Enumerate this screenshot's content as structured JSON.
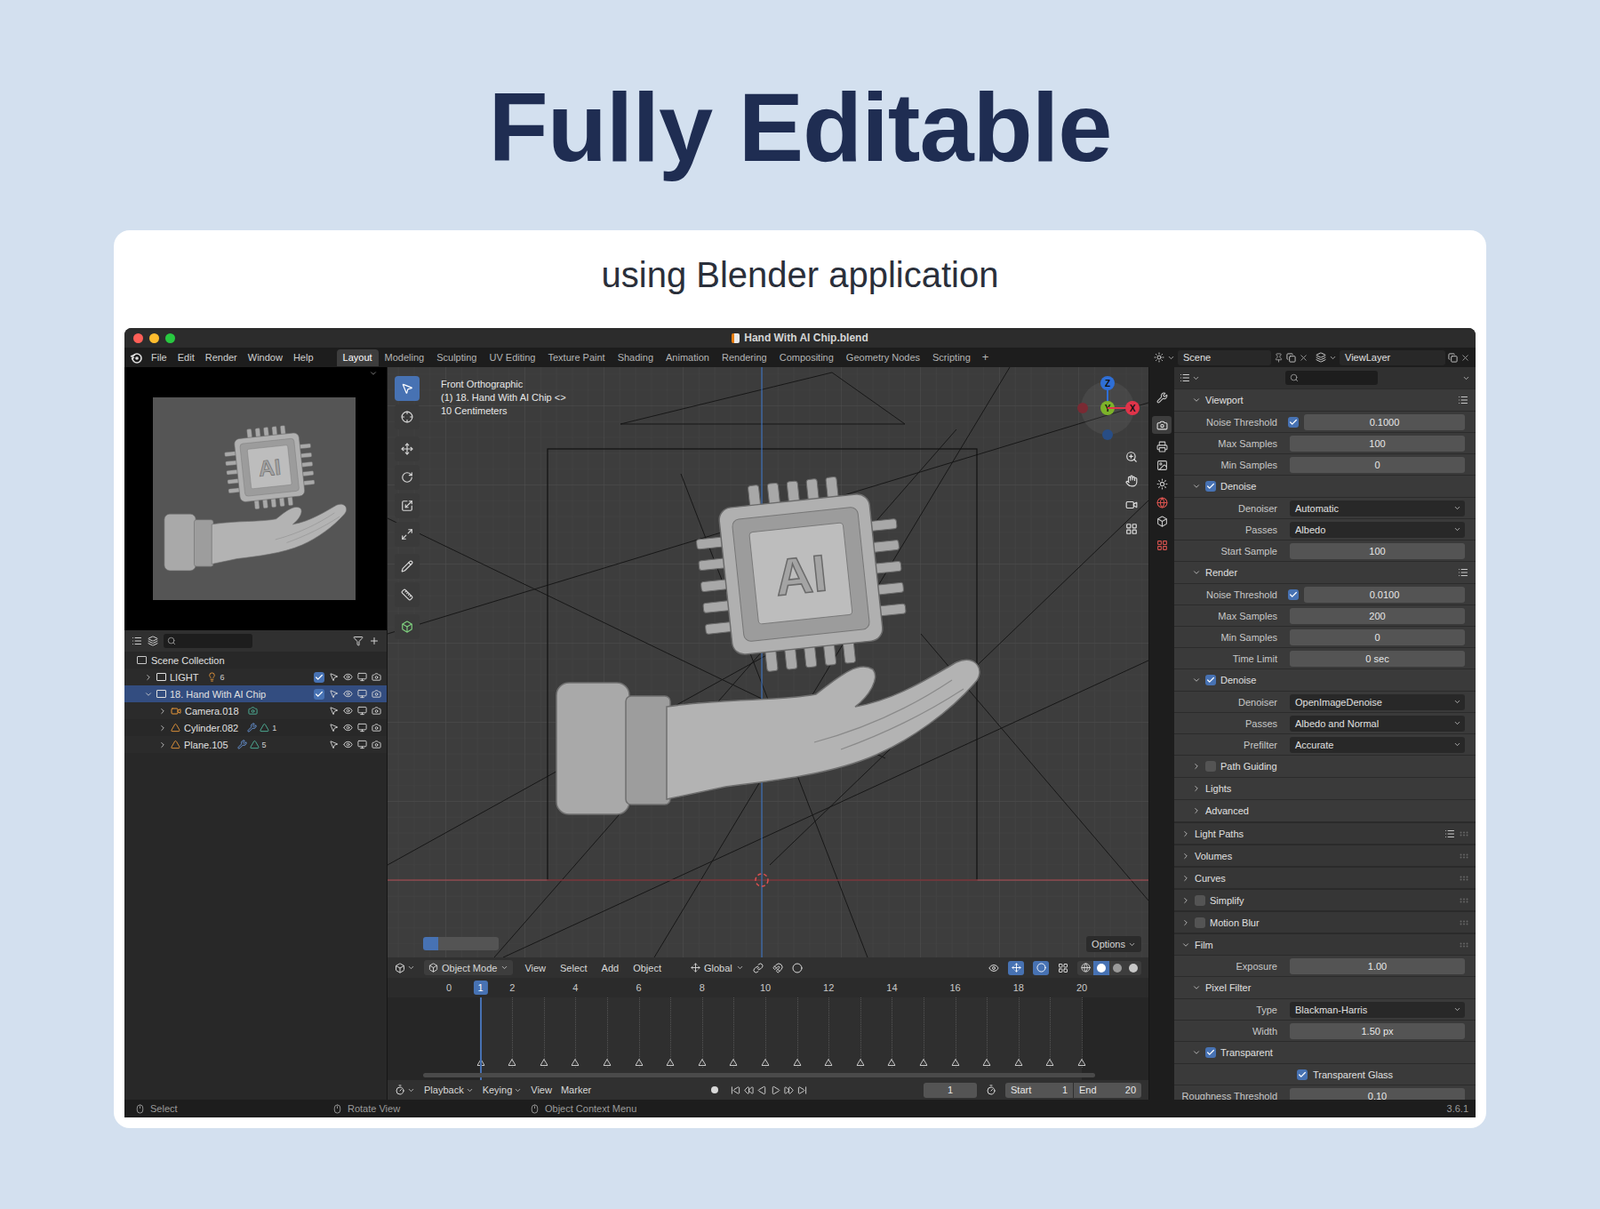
{
  "page": {
    "heading": "Fully Editable",
    "subtitle": "using Blender application"
  },
  "window": {
    "title": "Hand With AI Chip.blend"
  },
  "menu": [
    "File",
    "Edit",
    "Render",
    "Window",
    "Help"
  ],
  "workspaces": [
    {
      "label": "Layout",
      "selected": true
    },
    {
      "label": "Modeling",
      "selected": false
    },
    {
      "label": "Sculpting",
      "selected": false
    },
    {
      "label": "UV Editing",
      "selected": false
    },
    {
      "label": "Texture Paint",
      "selected": false
    },
    {
      "label": "Shading",
      "selected": false
    },
    {
      "label": "Animation",
      "selected": false
    },
    {
      "label": "Rendering",
      "selected": false
    },
    {
      "label": "Compositing",
      "selected": false
    },
    {
      "label": "Geometry Nodes",
      "selected": false
    },
    {
      "label": "Scripting",
      "selected": false
    }
  ],
  "add_workspace": "+",
  "scene": {
    "scene": "Scene",
    "view_layer": "ViewLayer"
  },
  "preview": {
    "chip_label": "AI"
  },
  "outliner": {
    "root": "Scene Collection",
    "items": [
      {
        "name": "LIGHT",
        "kind": "collection",
        "depth": 0,
        "expanded": false,
        "selected": false,
        "checked": true,
        "badge": "6"
      },
      {
        "name": "18. Hand With AI Chip",
        "kind": "collection",
        "depth": 0,
        "expanded": true,
        "selected": true,
        "checked": true
      },
      {
        "name": "Camera.018",
        "kind": "camera",
        "depth": 1,
        "expanded": false,
        "selected": false
      },
      {
        "name": "Cylinder.082",
        "kind": "mesh",
        "depth": 1,
        "expanded": false,
        "selected": false,
        "badge": "1"
      },
      {
        "name": "Plane.105",
        "kind": "mesh",
        "depth": 1,
        "expanded": false,
        "selected": false,
        "badge": "5"
      }
    ]
  },
  "viewport": {
    "view": "Front Orthographic",
    "object": "(1) 18. Hand With AI Chip <>",
    "scale": "10 Centimeters",
    "chip_label": "AI",
    "gizmo": [
      {
        "label": "Z",
        "color": "#2f6fd6"
      },
      {
        "label": "Y",
        "color": "#7cb32a"
      },
      {
        "label": "X",
        "color": "#e0344a"
      }
    ],
    "options": "Options"
  },
  "viewport_header": {
    "mode": "Object Mode",
    "menus": [
      "View",
      "Select",
      "Add",
      "Object"
    ],
    "orientation": "Global"
  },
  "timeline": {
    "frames": [
      "0",
      "2",
      "4",
      "6",
      "8",
      "10",
      "12",
      "14",
      "16",
      "18",
      "20"
    ],
    "current": "1",
    "menus": [
      "Playback",
      "Keying",
      "View",
      "Marker"
    ],
    "current_field": "1",
    "start_label": "Start",
    "start": "1",
    "end_label": "End",
    "end": "20"
  },
  "properties": {
    "rows": [
      {
        "kind": "panel",
        "label": "Viewport",
        "depth": 1,
        "expanded": true,
        "menu": true
      },
      {
        "kind": "check-number",
        "label": "Noise Threshold",
        "checked": true,
        "value": "0.1000"
      },
      {
        "kind": "number",
        "label": "Max Samples",
        "value": "100"
      },
      {
        "kind": "number",
        "label": "Min Samples",
        "value": "0"
      },
      {
        "kind": "check-panel",
        "label": "Denoise",
        "depth": 1,
        "expanded": true,
        "checked": true,
        "menu": false
      },
      {
        "kind": "dropdown",
        "label": "Denoiser",
        "value": "Automatic"
      },
      {
        "kind": "dropdown",
        "label": "Passes",
        "value": "Albedo"
      },
      {
        "kind": "number",
        "label": "Start Sample",
        "value": "100"
      },
      {
        "kind": "panel",
        "label": "Render",
        "depth": 1,
        "expanded": true,
        "menu": true
      },
      {
        "kind": "check-number",
        "label": "Noise Threshold",
        "checked": true,
        "value": "0.0100"
      },
      {
        "kind": "number",
        "label": "Max Samples",
        "value": "200"
      },
      {
        "kind": "number",
        "label": "Min Samples",
        "value": "0"
      },
      {
        "kind": "number",
        "label": "Time Limit",
        "value": "0 sec"
      },
      {
        "kind": "check-panel",
        "label": "Denoise",
        "depth": 1,
        "expanded": true,
        "checked": true,
        "menu": false
      },
      {
        "kind": "dropdown",
        "label": "Denoiser",
        "value": "OpenImageDenoise"
      },
      {
        "kind": "dropdown",
        "label": "Passes",
        "value": "Albedo and Normal"
      },
      {
        "kind": "dropdown",
        "label": "Prefilter",
        "value": "Accurate"
      },
      {
        "kind": "check-panel",
        "label": "Path Guiding",
        "depth": 1,
        "expanded": false,
        "checked": false,
        "menu": false
      },
      {
        "kind": "panel",
        "label": "Lights",
        "depth": 1,
        "expanded": false,
        "menu": false
      },
      {
        "kind": "panel",
        "label": "Advanced",
        "depth": 1,
        "expanded": false,
        "menu": false
      },
      {
        "kind": "panel",
        "label": "Light Paths",
        "depth": 0,
        "expanded": false,
        "menu": true
      },
      {
        "kind": "panel",
        "label": "Volumes",
        "depth": 0,
        "expanded": false,
        "menu": false
      },
      {
        "kind": "panel",
        "label": "Curves",
        "depth": 0,
        "expanded": false,
        "menu": false
      },
      {
        "kind": "check-panel",
        "label": "Simplify",
        "depth": 0,
        "expanded": false,
        "checked": false,
        "menu": false
      },
      {
        "kind": "check-panel",
        "label": "Motion Blur",
        "depth": 0,
        "expanded": false,
        "checked": false,
        "menu": false
      },
      {
        "kind": "panel",
        "label": "Film",
        "depth": 0,
        "expanded": true,
        "menu": false
      },
      {
        "kind": "number",
        "label": "Exposure",
        "value": "1.00"
      },
      {
        "kind": "panel",
        "label": "Pixel Filter",
        "depth": 1,
        "expanded": true,
        "menu": false
      },
      {
        "kind": "dropdown",
        "label": "Type",
        "value": "Blackman-Harris"
      },
      {
        "kind": "number",
        "label": "Width",
        "value": "1.50 px"
      },
      {
        "kind": "check-panel",
        "label": "Transparent",
        "depth": 1,
        "expanded": true,
        "checked": true,
        "menu": false
      },
      {
        "kind": "checkbox",
        "label": "Transparent Glass",
        "checked": true
      },
      {
        "kind": "number",
        "label": "Roughness Threshold",
        "value": "0.10"
      }
    ]
  },
  "status_bar": {
    "hints": [
      "Select",
      "Rotate View",
      "Object Context Menu"
    ],
    "version": "3.6.1"
  }
}
